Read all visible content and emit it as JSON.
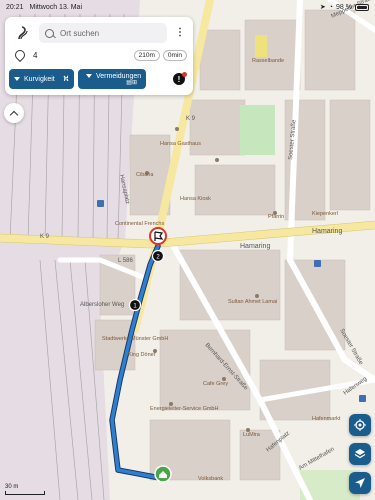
{
  "status": {
    "time": "20:21",
    "date": "Mittwoch 13. Mai",
    "battery": "98 %"
  },
  "route_panel": {
    "search": {
      "placeholder": "Ort suchen"
    },
    "destination": {
      "text": "4",
      "distance": "210m",
      "duration": "0min"
    },
    "options": [
      {
        "label": "Kurvigkeit",
        "icon": "road-curve-icon"
      },
      {
        "label": "Vermeidungen",
        "icon": "toll-booth-icon"
      }
    ]
  },
  "map": {
    "scale": "30 m",
    "accent_color": "#1a5d8c",
    "route_color": "#2f7fd0",
    "street_labels": [
      {
        "text": "Hamaring",
        "id": "hamaring-1"
      },
      {
        "text": "Hamaring",
        "id": "hamaring-2"
      },
      {
        "text": "K 9",
        "id": "k9-west"
      },
      {
        "text": "K 9",
        "id": "k9-north"
      },
      {
        "text": "L 586",
        "id": "l586"
      },
      {
        "text": "Bernhard-Ernst-Straße",
        "id": "bernhard-ernst"
      },
      {
        "text": "Soester Straße",
        "id": "soester-1"
      },
      {
        "text": "Soester Straße",
        "id": "soester-2"
      },
      {
        "text": "Hafenweg",
        "id": "hafenweg"
      },
      {
        "text": "Hafenplatz",
        "id": "hafenplatz"
      },
      {
        "text": "Am Mittelhafen",
        "id": "am-mittelhafen"
      },
      {
        "text": "Albersloher Weg",
        "id": "albersloher"
      },
      {
        "text": "Meppener Straße",
        "id": "meppener"
      },
      {
        "text": "Hansaplatz",
        "id": "hansaplatz"
      }
    ],
    "pois": [
      {
        "text": "Rasselbande"
      },
      {
        "text": "Cibaria"
      },
      {
        "text": "Hansa Kiosk"
      },
      {
        "text": "Pfarrin"
      },
      {
        "text": "Kiepenkerl"
      },
      {
        "text": "Sultan Ahmet Lamai"
      },
      {
        "text": "Stadtwerke Münster GmbH"
      },
      {
        "text": "King Döner"
      },
      {
        "text": "Cafe Grey"
      },
      {
        "text": "Energieleiter-Service GmbH"
      },
      {
        "text": "LuMira"
      },
      {
        "text": "Volksbank"
      },
      {
        "text": "Hafenmarkt"
      },
      {
        "text": "Continental Frenchs"
      },
      {
        "text": "Hansa Gasthaus"
      }
    ],
    "waypoint_numbers": [
      "1",
      "2"
    ]
  }
}
